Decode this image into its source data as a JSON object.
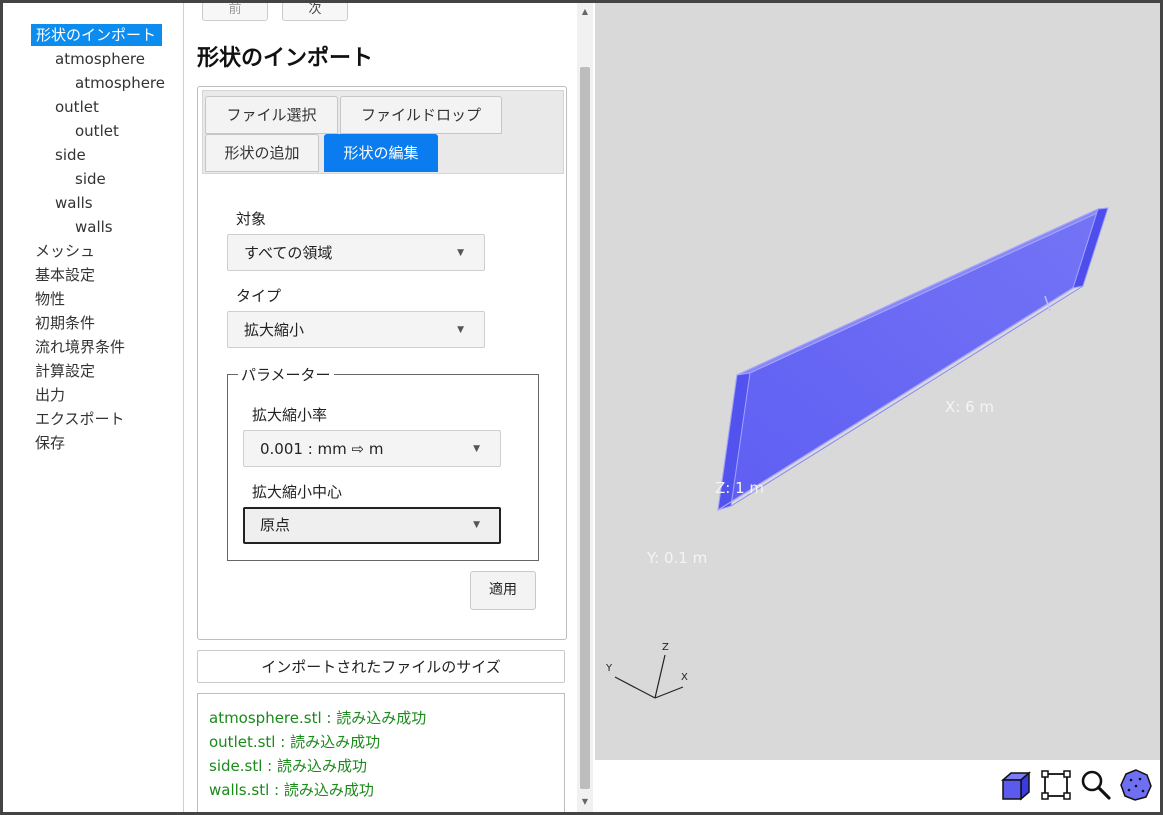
{
  "sidebar": {
    "items": [
      {
        "label": "形状のインポート",
        "level": 0,
        "selected": true
      },
      {
        "label": "atmosphere",
        "level": 1
      },
      {
        "label": "atmosphere",
        "level": 2
      },
      {
        "label": "outlet",
        "level": 1
      },
      {
        "label": "outlet",
        "level": 2
      },
      {
        "label": "side",
        "level": 1
      },
      {
        "label": "side",
        "level": 2
      },
      {
        "label": "walls",
        "level": 1
      },
      {
        "label": "walls",
        "level": 2
      },
      {
        "label": "メッシュ",
        "level": 0
      },
      {
        "label": "基本設定",
        "level": 0
      },
      {
        "label": "物性",
        "level": 0
      },
      {
        "label": "初期条件",
        "level": 0
      },
      {
        "label": "流れ境界条件",
        "level": 0
      },
      {
        "label": "計算設定",
        "level": 0
      },
      {
        "label": "出力",
        "level": 0
      },
      {
        "label": "エクスポート",
        "level": 0
      },
      {
        "label": "保存",
        "level": 0
      }
    ]
  },
  "nav": {
    "prev_label": "前",
    "next_label": "次"
  },
  "page_title": "形状のインポート",
  "tabs": [
    {
      "label": "ファイル選択",
      "active": false
    },
    {
      "label": "ファイルドロップ",
      "active": false
    },
    {
      "label": "形状の追加",
      "active": false
    },
    {
      "label": "形状の編集",
      "active": true
    }
  ],
  "form": {
    "target_label": "対象",
    "target_value": "すべての領域",
    "type_label": "タイプ",
    "type_value": "拡大縮小",
    "params_legend": "パラメーター",
    "scale_label": "拡大縮小率",
    "scale_value": "0.001 : mm ⇨ m",
    "center_label": "拡大縮小中心",
    "center_value": "原点",
    "apply_label": "適用"
  },
  "imported_size_button": "インポートされたファイルのサイズ",
  "import_log": [
    "atmosphere.stl : 読み込み成功",
    "outlet.stl : 読み込み成功",
    "side.stl : 読み込み成功",
    "walls.stl : 読み込み成功"
  ],
  "viewer": {
    "dimension_labels": {
      "x": "X: 6 m",
      "y": "Y: 0.1 m",
      "z": "Z: 1 m"
    },
    "axes": {
      "x": "X",
      "y": "Y",
      "z": "Z"
    },
    "shape_color": "#6a6af5",
    "background_color": "#d9d9d9"
  },
  "toolbar": {
    "icons": [
      "cube-view-icon",
      "fit-frame-icon",
      "zoom-icon",
      "orbit-sphere-icon"
    ]
  },
  "colors": {
    "accent": "#0a7cf0",
    "success_text": "#1a8a1a"
  }
}
